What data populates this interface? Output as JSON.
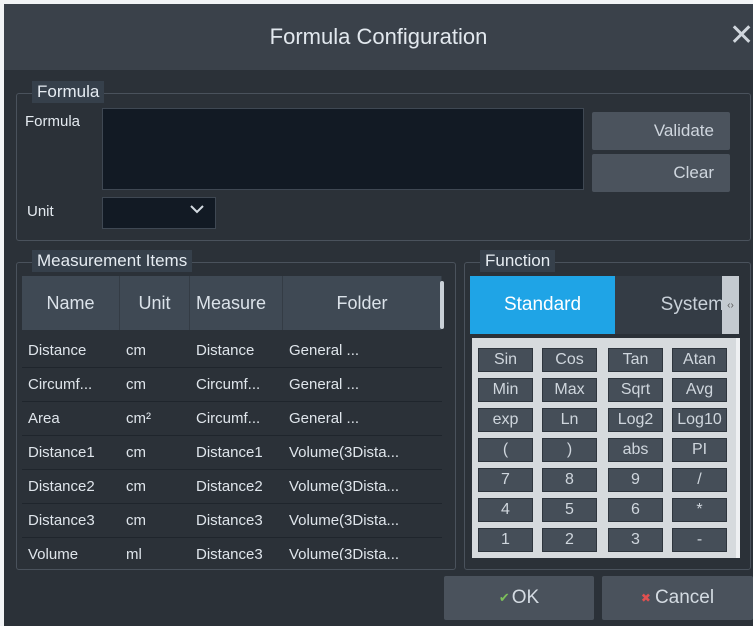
{
  "dialog": {
    "title": "Formula Configuration"
  },
  "formula_group": {
    "legend": "Formula",
    "formula_label": "Formula",
    "formula_value": "",
    "unit_label": "Unit",
    "unit_value": "",
    "validate_label": "Validate",
    "clear_label": "Clear"
  },
  "measurement": {
    "legend": "Measurement Items",
    "columns": [
      "Name",
      "Unit",
      "Measure",
      "Folder"
    ],
    "rows": [
      [
        "Distance",
        "cm",
        "Distance",
        "General ..."
      ],
      [
        "Circumf...",
        "cm",
        "Circumf...",
        "General ..."
      ],
      [
        "Area",
        "cm²",
        "Circumf...",
        "General ..."
      ],
      [
        "Distance1",
        "cm",
        "Distance1",
        "Volume(3Dista..."
      ],
      [
        "Distance2",
        "cm",
        "Distance2",
        "Volume(3Dista..."
      ],
      [
        "Distance3",
        "cm",
        "Distance3",
        "Volume(3Dista..."
      ],
      [
        "Volume",
        "ml",
        "Distance3",
        "Volume(3Dista..."
      ]
    ]
  },
  "function": {
    "legend": "Function",
    "tabs": [
      "Standard",
      "System"
    ],
    "keys": [
      [
        "Sin",
        "Cos",
        "Tan",
        "Atan"
      ],
      [
        "Min",
        "Max",
        "Sqrt",
        "Avg"
      ],
      [
        "exp",
        "Ln",
        "Log2",
        "Log10"
      ],
      [
        "(",
        ")",
        "abs",
        "PI"
      ],
      [
        "7",
        "8",
        "9",
        "/"
      ],
      [
        "4",
        "5",
        "6",
        "*"
      ],
      [
        "1",
        "2",
        "3",
        "-"
      ]
    ]
  },
  "footer": {
    "ok_label": "OK",
    "cancel_label": "Cancel"
  },
  "colors": {
    "accent": "#1fa4e6",
    "background": "#2b3138",
    "titlebar": "#3a414a"
  }
}
